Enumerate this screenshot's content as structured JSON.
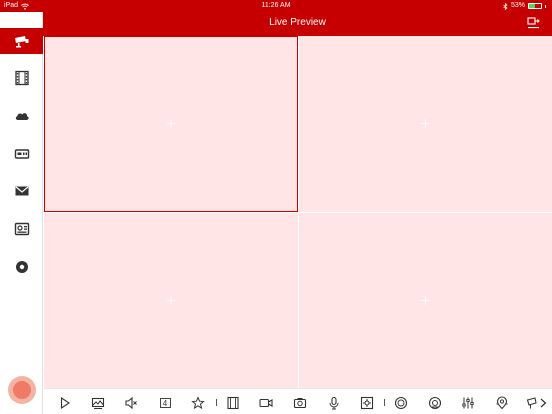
{
  "status_bar": {
    "device": "iPad",
    "time": "11:26 AM",
    "bluetooth_icon": "bluetooth-icon",
    "battery_text": "53%",
    "battery_level": 0.53
  },
  "header": {
    "title": "Live Preview",
    "exit_icon": "exit-fullscreen-icon"
  },
  "sidebar": {
    "items": [
      {
        "name": "sidebar-item-live-preview",
        "icon": "camera-icon",
        "active": true
      },
      {
        "name": "sidebar-item-playback",
        "icon": "film-icon",
        "active": false
      },
      {
        "name": "sidebar-item-cloud",
        "icon": "cloud-icon",
        "active": false
      },
      {
        "name": "sidebar-item-devices",
        "icon": "dvr-icon",
        "active": false
      },
      {
        "name": "sidebar-item-messages",
        "icon": "mail-icon",
        "active": false
      },
      {
        "name": "sidebar-item-tools",
        "icon": "panel-icon",
        "active": false
      },
      {
        "name": "sidebar-item-settings",
        "icon": "gear-icon",
        "active": false
      }
    ]
  },
  "grid": {
    "panes": [
      {
        "label": "+",
        "selected": true
      },
      {
        "label": "+",
        "selected": false
      },
      {
        "label": "+",
        "selected": false
      },
      {
        "label": "+",
        "selected": false
      }
    ]
  },
  "toolbar": {
    "window_count": "4",
    "tools": [
      "play-icon",
      "image-icon",
      "mute-icon",
      "window-count-icon",
      "star-icon",
      "film-icon",
      "record-icon",
      "capture-icon",
      "microphone-icon",
      "ptz-icon",
      "focus-icon",
      "iris-icon",
      "adjust-icon",
      "preset-icon",
      "more-icon",
      "next-icon"
    ]
  },
  "colors": {
    "accent": "#c60000",
    "pane_bg": "#ffe5e5",
    "battery": "#4cd964"
  }
}
